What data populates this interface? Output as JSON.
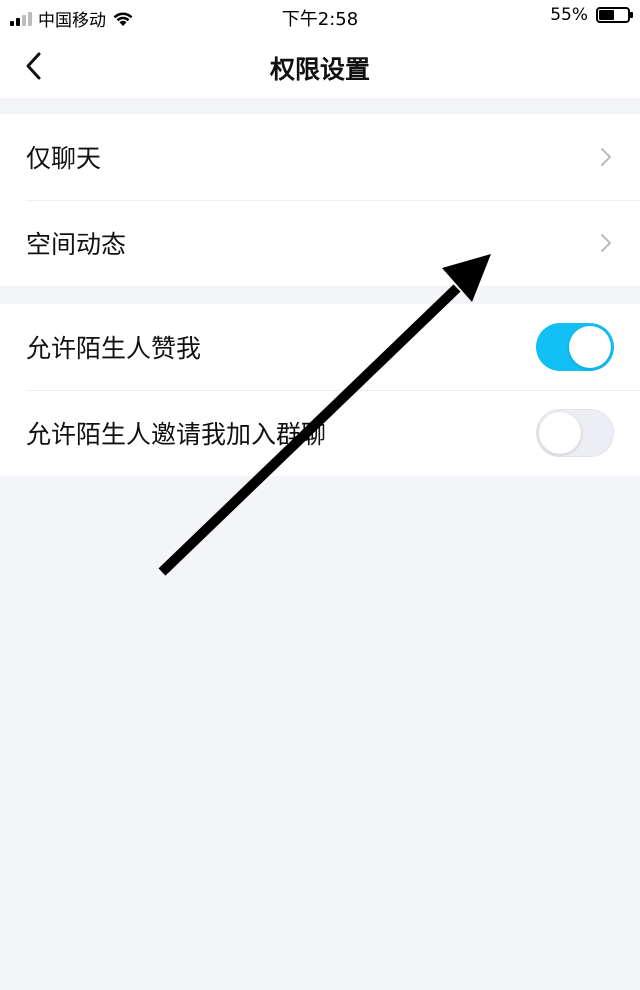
{
  "status_bar": {
    "carrier": "中国移动",
    "time": "下午2:58",
    "battery_percent": "55%",
    "battery_level": 0.55,
    "signal_icon": "signal-bars-icon",
    "wifi_icon": "wifi-icon",
    "battery_icon": "battery-icon"
  },
  "nav": {
    "title": "权限设置",
    "back_icon": "chevron-left-icon"
  },
  "groups": [
    {
      "items": [
        {
          "label": "仅聊天",
          "type": "link",
          "icon": "chevron-right-icon"
        },
        {
          "label": "空间动态",
          "type": "link",
          "icon": "chevron-right-icon"
        }
      ]
    },
    {
      "items": [
        {
          "label": "允许陌生人赞我",
          "type": "toggle",
          "on": true
        },
        {
          "label": "允许陌生人邀请我加入群聊",
          "type": "toggle",
          "on": false
        }
      ]
    }
  ],
  "colors": {
    "accent": "#12c0f5",
    "background": "#f4f5f9",
    "card": "#ffffff",
    "toggle_off": "#eceef3",
    "chevron": "#b9bcc4",
    "annotation_arrow": "#000000"
  },
  "annotation": {
    "icon": "arrow-annotation-icon"
  }
}
